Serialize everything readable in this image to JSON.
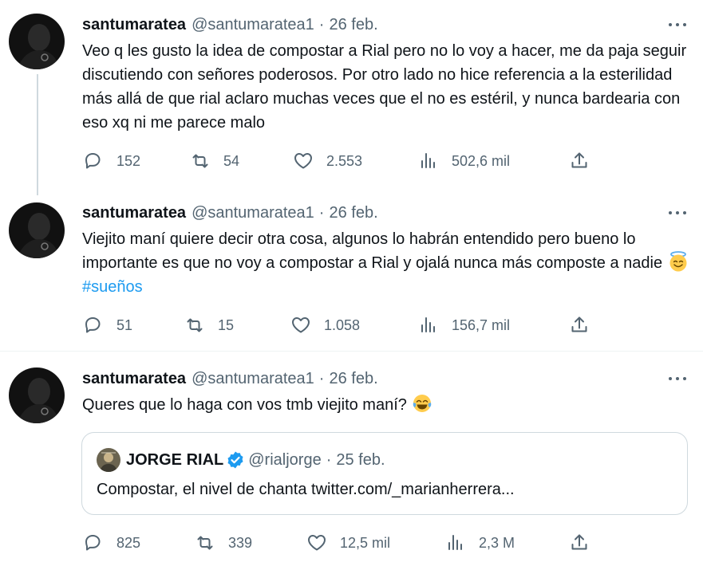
{
  "tweets": [
    {
      "name": "santumaratea",
      "handle": "@santumaratea1",
      "separator": "·",
      "date": "26 feb.",
      "text": "Veo q les gusto la idea de compostar a Rial pero no lo voy a hacer, me da paja seguir discutiendo con señores poderosos. Por otro lado no hice referencia a la esterilidad más allá de que rial aclaro muchas veces que el no es estéril, y nunca bardearia con eso xq ni me parece malo",
      "replies": "152",
      "retweets": "54",
      "likes": "2.553",
      "views": "502,6 mil"
    },
    {
      "name": "santumaratea",
      "handle": "@santumaratea1",
      "separator": "·",
      "date": "26 feb.",
      "text": "Viejito maní quiere decir otra cosa, algunos lo habrán entendido pero bueno lo importante es que no voy a compostar a Rial y ojalá nunca más composte a nadie",
      "emoji": "smiling-face-with-halo",
      "hashtag": "#sueños",
      "replies": "51",
      "retweets": "15",
      "likes": "1.058",
      "views": "156,7 mil"
    },
    {
      "name": "santumaratea",
      "handle": "@santumaratea1",
      "separator": "·",
      "date": "26 feb.",
      "text": "Queres que lo haga con vos tmb viejito maní?",
      "emoji": "face-with-tears-of-joy",
      "replies": "825",
      "retweets": "339",
      "likes": "12,5 mil",
      "views": "2,3 M",
      "quote": {
        "name": "JORGE RIAL",
        "verified": true,
        "handle": "@rialjorge",
        "separator": "·",
        "date": "25 feb.",
        "text": "Compostar, el nivel de chanta twitter.com/_marianherrera..."
      }
    }
  ],
  "colors": {
    "text": "#0f1419",
    "secondary": "#536471",
    "link": "#1d9bf0",
    "border": "#cfd9de",
    "verified": "#1d9bf0"
  },
  "icons": [
    "more-icon",
    "reply-icon",
    "retweet-icon",
    "like-icon",
    "views-icon",
    "share-icon",
    "verified-icon"
  ]
}
